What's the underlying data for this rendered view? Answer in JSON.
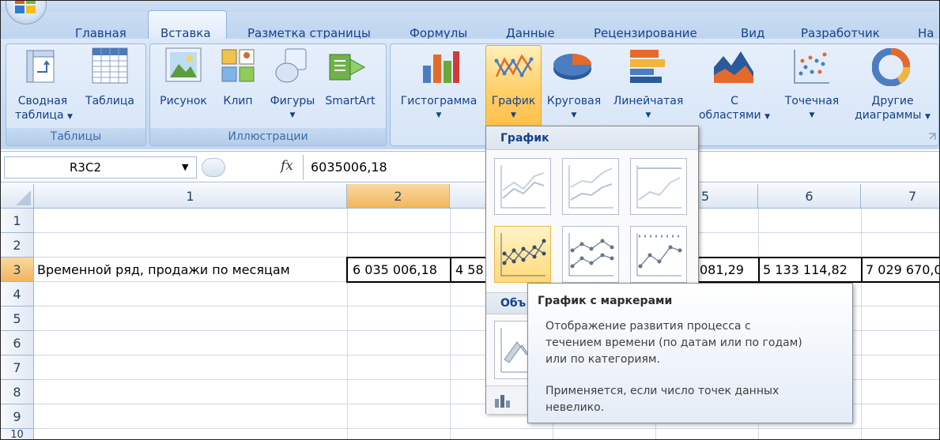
{
  "tabs": [
    "Главная",
    "Вставка",
    "Разметка страницы",
    "Формулы",
    "Данные",
    "Рецензирование",
    "Вид",
    "Разработчик",
    "На"
  ],
  "ribbon": {
    "tables_group": {
      "title": "Таблицы",
      "pivot_line1": "Сводная",
      "pivot_line2": "таблица",
      "table": "Таблица"
    },
    "illustrations_group": {
      "title": "Иллюстрации",
      "picture": "Рисунок",
      "clip": "Клип",
      "shapes": "Фигуры",
      "smartart": "SmartArt"
    },
    "charts_group": {
      "histogram": "Гистограмма",
      "line": "График",
      "pie": "Круговая",
      "bar": "Линейчатая",
      "area_line1": "С",
      "area_line2": "областями",
      "scatter": "Точечная",
      "other_line1": "Другие",
      "other_line2": "диаграммы"
    }
  },
  "formula_bar": {
    "name_box": "R3C2",
    "fx": "fx",
    "value": "6035006,18"
  },
  "grid": {
    "columns": [
      "1",
      "2",
      "",
      "",
      "5",
      "6",
      "7"
    ],
    "rows": [
      "1",
      "2",
      "3",
      "4",
      "5",
      "6",
      "7",
      "8",
      "9",
      "10"
    ],
    "row3": {
      "label": "Временной ряд, продажи по месяцам",
      "c2": "6 035 006,18",
      "c3": "4 58",
      "c5": "081,29",
      "c6": "5 133 114,82",
      "c7": "7 029 670,0"
    }
  },
  "gallery": {
    "header": "График",
    "section2_partial": "Объ"
  },
  "tooltip": {
    "title": "График с маркерами",
    "line1": "Отображение развития процесса с",
    "line2": "течением времени (по датам или по годам)",
    "line3": "или по категориям.",
    "line4": "Применяется, если число точек данных",
    "line5": "невелико."
  },
  "colors": {
    "accent": "#15428b",
    "selected_header": "#f2b55e",
    "ribbon": "#c7dbf3",
    "hover": "#ffd978"
  }
}
